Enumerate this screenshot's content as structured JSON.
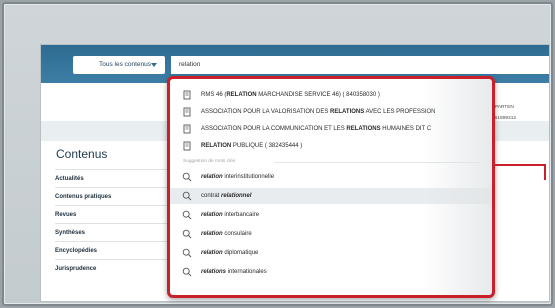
{
  "header": {
    "scope_label": "Tous les contenus",
    "search_value": "relation"
  },
  "background_text": {
    "line1": "LE DEPARTEN",
    "line2": "OET | 51899312"
  },
  "sidebar": {
    "title": "Contenus",
    "items": [
      {
        "label": "Actualités"
      },
      {
        "label": "Contenus pratiques"
      },
      {
        "label": "Revues"
      },
      {
        "label": "Synthèses"
      },
      {
        "label": "Encyclopédies"
      },
      {
        "label": "Jurisprudence"
      }
    ]
  },
  "dropdown": {
    "companies": [
      {
        "before": "RMS 46 (",
        "bold": "RELATION",
        "after": " MARCHANDISE SERVICE 46) ( 840358030 )"
      },
      {
        "before": "ASSOCIATION POUR LA VALORISATION DES ",
        "bold": "RELATIONS",
        "after": " AVEC LES PROFESSION"
      },
      {
        "before": "ASSOCIATION POUR LA COMMUNICATION ET LES ",
        "bold": "RELATIONS",
        "after": " HUMAINES DIT C"
      },
      {
        "before": "",
        "bold": "RELATION",
        "after": " PUBLIQUE ( 382435444 )"
      }
    ],
    "keywords_heading": "Suggestion de mots clés",
    "keywords": [
      {
        "before": "",
        "bold": "relation",
        "after": " interinstitutionnelle"
      },
      {
        "before": "contrat ",
        "bold": "relationnel",
        "after": ""
      },
      {
        "before": "",
        "bold": "relation",
        "after": " interbancaire"
      },
      {
        "before": "",
        "bold": "relation",
        "after": " consulaire"
      },
      {
        "before": "",
        "bold": "relation",
        "after": " diplomatique"
      },
      {
        "before": "",
        "bold": "relations",
        "after": " internationales"
      }
    ]
  },
  "icons": {
    "company": "building-icon",
    "keyword": "search-icon",
    "scope": "dropdown-triangle-icon"
  },
  "colors": {
    "header_blue": "#2e6b91",
    "highlight_red": "#c9202a"
  }
}
